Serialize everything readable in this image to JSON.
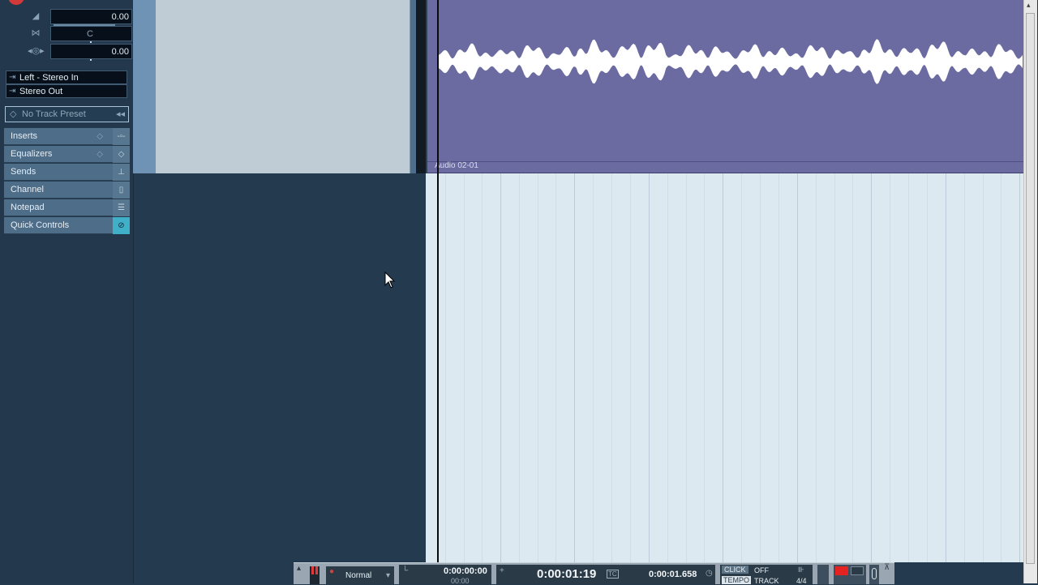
{
  "inspector": {
    "volume_value": "0.00",
    "pan_value": "C",
    "delay_value": "0.00",
    "input_routing": "Left - Stereo In",
    "output_routing": "Stereo Out",
    "track_preset": "No Track Preset",
    "sections": [
      {
        "label": "Inserts"
      },
      {
        "label": "Equalizers"
      },
      {
        "label": "Sends"
      },
      {
        "label": "Channel"
      },
      {
        "label": "Notepad"
      },
      {
        "label": "Quick Controls"
      }
    ]
  },
  "event": {
    "name": "Audio 02-01"
  },
  "transport": {
    "mode": "Normal",
    "left_locator": "0:00:00:00",
    "left_locator_sub": "00:00",
    "primary_time": "0:00:01:19",
    "tc_label": "TC",
    "secondary_time": "0:00:01.658",
    "click_label": "CLICK",
    "click_state": "OFF",
    "tempo_label": "TEMPO",
    "track_label": "TRACK",
    "signature": "4/4"
  },
  "colors": {
    "event_bg": "#6b6ba2",
    "lane_bg": "#dde9f0",
    "inspector_bg": "#23384c",
    "section_bg": "#4d6d89",
    "quick_controls_accent": "#3fb0c8"
  }
}
